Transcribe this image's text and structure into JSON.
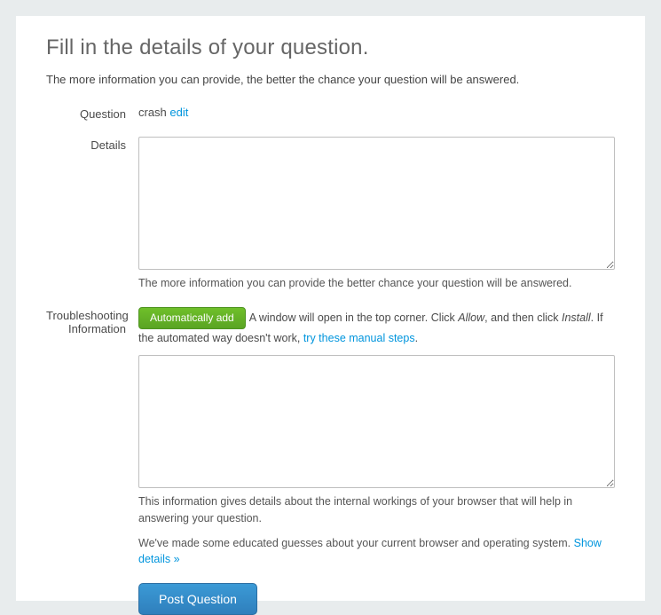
{
  "heading": "Fill in the details of your question.",
  "subhead": "The more information you can provide, the better the chance your question will be answered.",
  "labels": {
    "question": "Question",
    "details": "Details",
    "troub": "Troubleshooting Information"
  },
  "question": {
    "text": "crash",
    "edit_link": "edit"
  },
  "details": {
    "value": "",
    "hint": "The more information you can provide the better chance your question will be answered."
  },
  "troub": {
    "auto_btn": "Automatically add",
    "instr1": "A window will open in the top corner. Click ",
    "allow": "Allow",
    "instr2": ", and then click ",
    "install": "Install",
    "instr3": ". If the automated way doesn't work, ",
    "manual_link": "try these manual steps",
    "instr4": ".",
    "value": "",
    "hint1": "This information gives details about the internal workings of your browser that will help in answering your question.",
    "hint2a": "We've made some educated guesses about your current browser and operating system. ",
    "show_details": "Show details »"
  },
  "post_btn": "Post Question"
}
